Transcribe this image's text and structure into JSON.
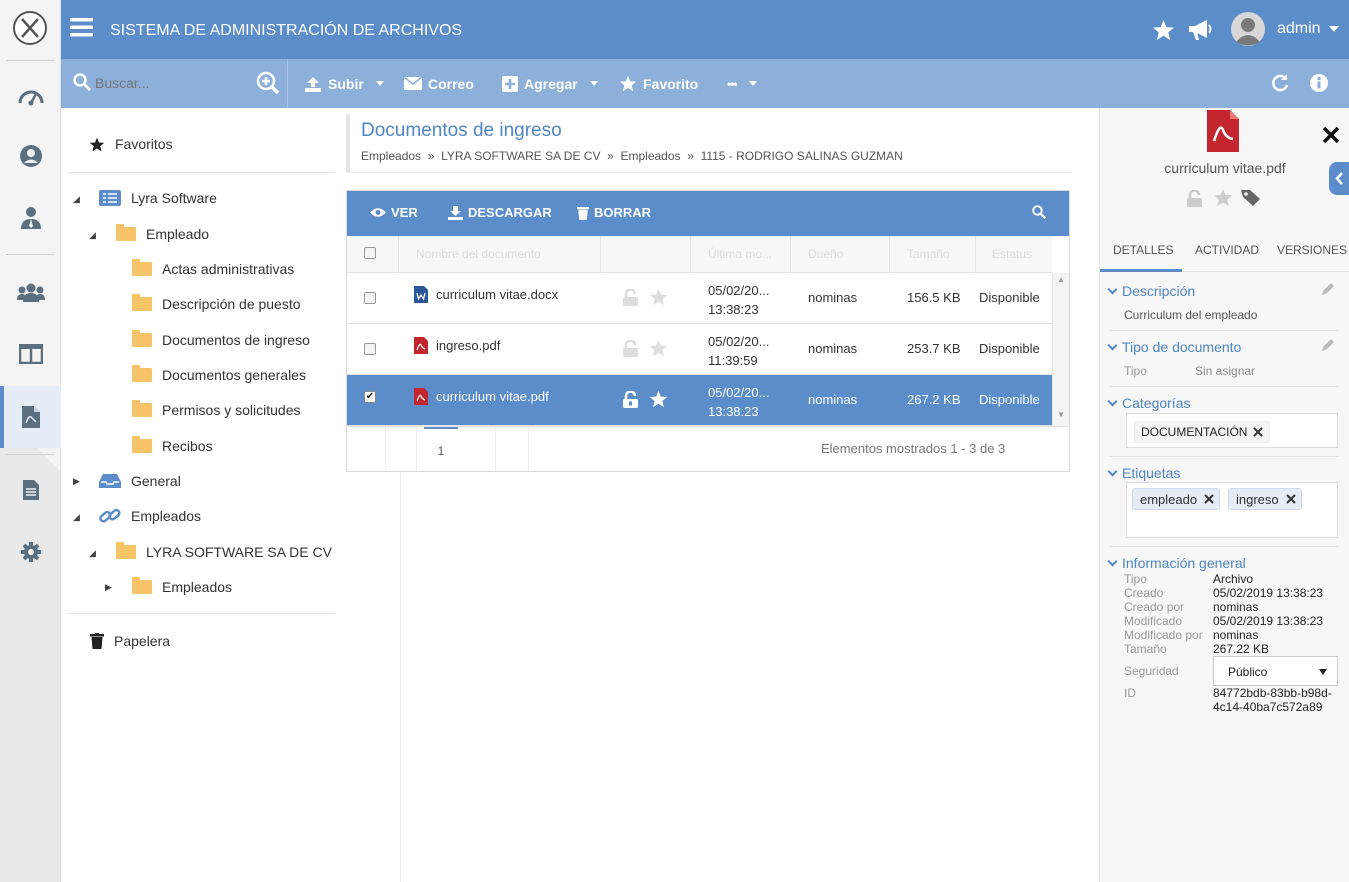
{
  "app": {
    "title": "SISTEMA DE ADMINISTRACIÓN DE ARCHIVOS",
    "user": "admin"
  },
  "colors": {
    "primary": "#5b8dcb",
    "toolbar": "#8db0db",
    "pdf_red": "#c4262e",
    "folder": "#f6c467",
    "word_blue": "#2b579a"
  },
  "leftbar": {
    "items": [
      "dashboard-icon",
      "user-circle-icon",
      "user-tie-icon",
      "users-icon",
      "columns-icon",
      "file-pdf-icon",
      "file-text-icon",
      "gear-icon"
    ],
    "active_index": 5
  },
  "toolbar": {
    "search_placeholder": "Buscar...",
    "upload": "Subir",
    "mail": "Correo",
    "add": "Agregar",
    "favorite": "Favorito",
    "more": "•••"
  },
  "tree": {
    "favorites": "Favoritos",
    "nodes": [
      "Lyra Software",
      "Empleado",
      "Actas administrativas",
      "Descripción de puesto",
      "Documentos de ingreso",
      "Documentos generales",
      "Permisos y solicitudes",
      "Recibos",
      "General",
      "Empleados",
      "LYRA SOFTWARE SA DE CV",
      "Empleados"
    ],
    "trash": "Papelera"
  },
  "page": {
    "title": "Documentos de ingreso",
    "breadcrumb": [
      "Empleados",
      "LYRA SOFTWARE SA DE CV",
      "Empleados",
      "1115 - RODRIGO SALINAS GUZMAN"
    ],
    "breadcrumb_sep": "»"
  },
  "grid": {
    "actions": {
      "view": "VER",
      "download": "DESCARGAR",
      "delete": "BORRAR"
    },
    "headers": [
      "Nombre del documento",
      "Última mo...",
      "Dueño",
      "Tamaño",
      "Estatus"
    ],
    "rows": [
      {
        "name": "curriculum vitae.docx",
        "type": "word",
        "date": "05/02/20...",
        "time": "13:38:23",
        "owner": "nominas",
        "size": "156.5 KB",
        "status": "Disponible",
        "selected": false
      },
      {
        "name": "ingreso.pdf",
        "type": "pdf",
        "date": "05/02/20...",
        "time": "11:39:59",
        "owner": "nominas",
        "size": "253.7 KB",
        "status": "Disponible",
        "selected": false
      },
      {
        "name": "curriculum vitae.pdf",
        "type": "pdf",
        "date": "05/02/20...",
        "time": "13:38:23",
        "owner": "nominas",
        "size": "267.2 KB",
        "status": "Disponible",
        "selected": true
      }
    ],
    "page": "1",
    "footer": "Elementos mostrados 1 - 3 de 3"
  },
  "details": {
    "file_name": "curriculum vitae.pdf",
    "tabs": [
      "DETALLES",
      "ACTIVIDAD",
      "VERSIONES"
    ],
    "description_title": "Descripción",
    "description": "Curriculum del empleado",
    "doc_type_title": "Tipo de documento",
    "doc_type_label": "Tipo",
    "doc_type_value": "Sin asignar",
    "categories_title": "Categorías",
    "category": "DOCUMENTACIÓN",
    "tags_title": "Etiquetas",
    "tags": [
      "empleado",
      "ingreso"
    ],
    "general_title": "Información general",
    "info": {
      "tipo_label": "Tipo",
      "tipo": "Archivo",
      "creado_label": "Creado",
      "creado": "05/02/2019 13:38:23",
      "creado_por_label": "Creado por",
      "creado_por": "nominas",
      "modificado_label": "Modificado",
      "modificado": "05/02/2019 13:38:23",
      "modificado_por_label": "Modificado por",
      "modificado_por": "nominas",
      "tamano_label": "Tamaño",
      "tamano": "267.22 KB",
      "seguridad_label": "Seguridad",
      "seguridad": "Público",
      "id_label": "ID",
      "id_line1": "84772bdb-83bb-b98d-",
      "id_line2": "4c14-40ba7c572a89"
    }
  }
}
